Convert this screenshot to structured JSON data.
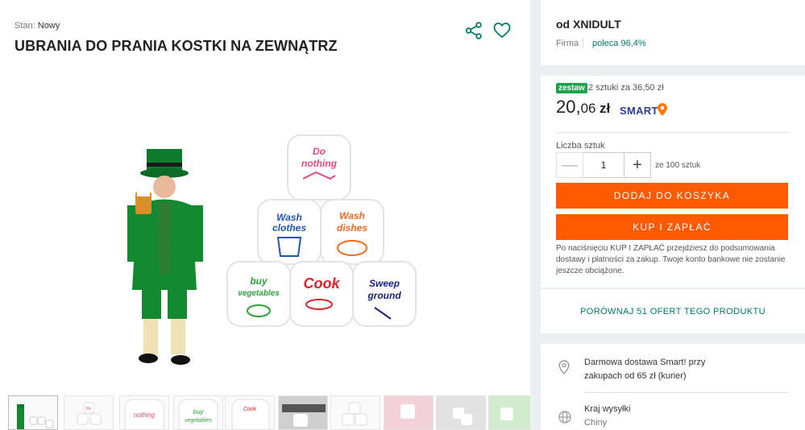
{
  "product": {
    "condition_label": "Stan:",
    "condition_value": "Nowy",
    "title": "UBRANIA DO PRANIA KOSTKI NA ZEWNĄTRZ"
  },
  "main_image": {
    "dice_texts": [
      [
        "Do",
        "nothing"
      ],
      [
        "Wash",
        "clothes"
      ],
      [
        "Wash",
        "dishes"
      ],
      [
        "buy",
        "vegetables"
      ],
      [
        "Cook"
      ],
      [
        "Sweep",
        "ground"
      ]
    ]
  },
  "seller": {
    "name": "od XNIDULT",
    "type": "Firma",
    "recommend": "poleca 96,4%"
  },
  "offer": {
    "set_badge": "zestaw",
    "set_text": "2 sztuki za 36,50 zł",
    "price_int": "20,",
    "price_dec": "06",
    "currency": "zł",
    "smart_label": "SMART"
  },
  "quantity": {
    "label": "Liczba sztuk",
    "minus": "—",
    "value": "1",
    "plus": "+",
    "of_total": "ze 100 sztuk"
  },
  "buttons": {
    "add_to_cart": "DODAJ DO KOSZYKA",
    "buy_now": "KUP I ZAPŁAĆ"
  },
  "buy_note": "Po naciśnięciu KUP I ZAPŁAĆ przejdziesz do podsumowania dostawy i płatności za zakup. Twoje konto bankowe nie zostanie jeszcze obciążone.",
  "compare": {
    "label": "PORÓWNAJ 51 OFERT TEGO PRODUKTU"
  },
  "delivery": {
    "free_text": "Darmowa dostawa Smart! przy zakupach od 65 zł (kurier)",
    "ship_label": "Kraj wysyłki",
    "ship_value": "Chiny"
  },
  "colors": {
    "accent_orange": "#ff5a00",
    "teal_link": "#00776b",
    "badge_green": "#1aa34a",
    "smart_navy": "#2c3e91"
  }
}
